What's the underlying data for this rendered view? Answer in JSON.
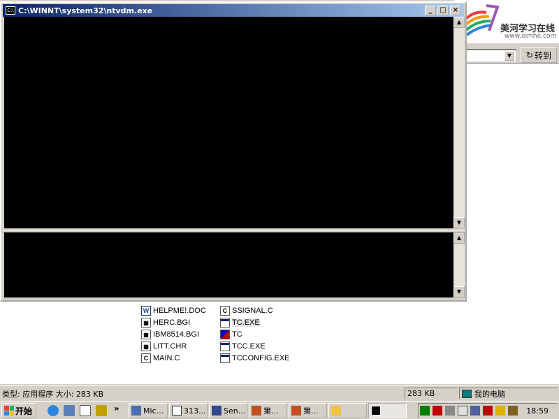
{
  "console_window": {
    "title": "C:\\WINNT\\system32\\ntvdm.exe",
    "sysicon_label": "C:\\"
  },
  "explorer": {
    "goto_label": "转到"
  },
  "logo": {
    "name": "美河学习在线",
    "url": "www.eimhe.com"
  },
  "files": [
    {
      "name": "HELPME!.DOC",
      "icon": "doc-icon"
    },
    {
      "name": "SSIGNAL.C",
      "icon": "c-file-icon"
    },
    {
      "name": "HERC.BGI",
      "icon": "bgi-icon"
    },
    {
      "name": "TC.EXE",
      "icon": "exe-icon",
      "selected": true
    },
    {
      "name": "IBM8514.BGI",
      "icon": "bgi-icon"
    },
    {
      "name": "TC",
      "icon": "tc-icon"
    },
    {
      "name": "LITT.CHR",
      "icon": "chr-icon"
    },
    {
      "name": "TCC.EXE",
      "icon": "exe-icon"
    },
    {
      "name": "MAIN.C",
      "icon": "c-file-icon"
    },
    {
      "name": "TCCONFIG.EXE",
      "icon": "exe-icon"
    }
  ],
  "statusbar": {
    "description": "类型: 应用程序 大小: 283 KB",
    "size": "283 KB",
    "location": "我的电脑"
  },
  "taskbar": {
    "start_label": "开始",
    "buttons": [
      {
        "label": "Mic..."
      },
      {
        "label": "313..."
      },
      {
        "label": "Sen..."
      },
      {
        "label": "第..."
      },
      {
        "label": "第..."
      },
      {
        "label": ""
      },
      {
        "label": ""
      }
    ],
    "quicklaunch_more": "»",
    "clock": "18:59"
  },
  "colors": {
    "titlebar_start": "#0a246a",
    "titlebar_end": "#a6caf0",
    "face": "#d4d0c8",
    "console_bg": "#000000"
  }
}
